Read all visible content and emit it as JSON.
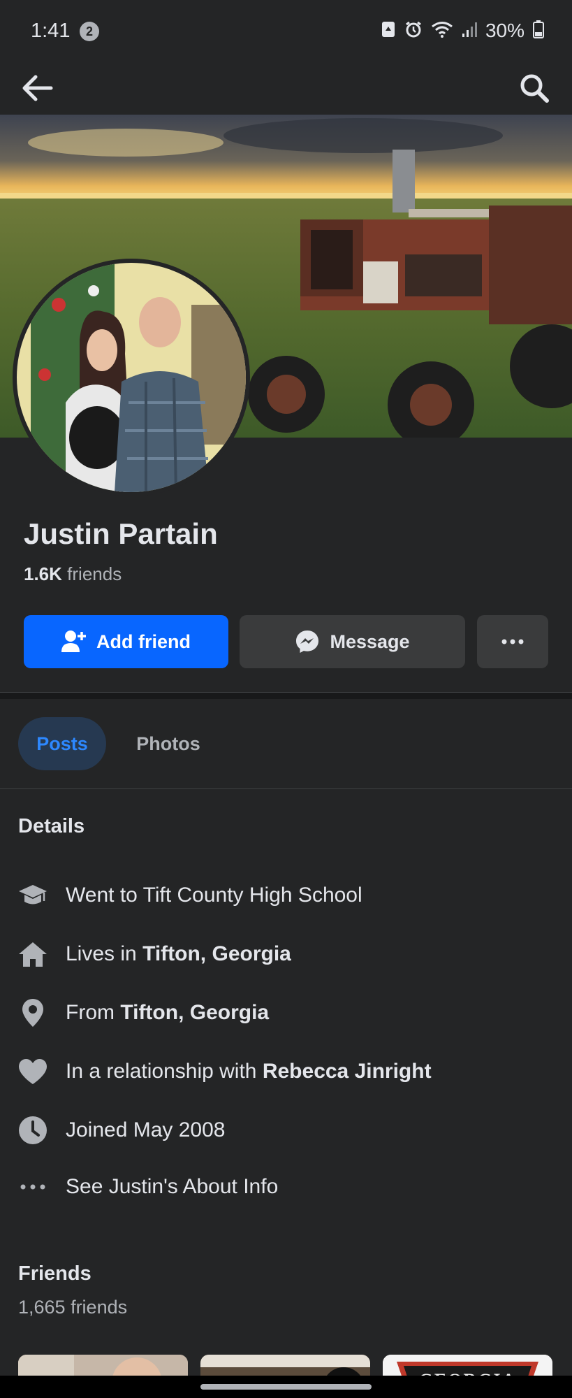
{
  "status_bar": {
    "time": "1:41",
    "notification_count": "2",
    "battery": "30%"
  },
  "profile": {
    "name": "Justin Partain",
    "friends_count_bold": "1.6K",
    "friends_count_label": "friends"
  },
  "actions": {
    "add_friend": "Add friend",
    "message": "Message"
  },
  "tabs": [
    {
      "label": "Posts",
      "active": true
    },
    {
      "label": "Photos",
      "active": false
    }
  ],
  "details": {
    "title": "Details",
    "items": [
      {
        "icon": "graduation-cap-icon",
        "prefix": "Went to Tift County High School",
        "bold": ""
      },
      {
        "icon": "home-icon",
        "prefix": "Lives in ",
        "bold": "Tifton, Georgia"
      },
      {
        "icon": "location-pin-icon",
        "prefix": "From ",
        "bold": "Tifton, Georgia"
      },
      {
        "icon": "heart-icon",
        "prefix": "In a relationship with ",
        "bold": "Rebecca Jinright"
      },
      {
        "icon": "clock-icon",
        "prefix": "Joined May 2008",
        "bold": ""
      },
      {
        "icon": "more-dots-icon",
        "prefix": "See Justin's About Info",
        "bold": ""
      }
    ]
  },
  "friends_section": {
    "title": "Friends",
    "count": "1,665 friends",
    "thumb_text": "GEORGIA"
  },
  "colors": {
    "background": "#242526",
    "primary_button": "#0866ff",
    "secondary_button": "#3a3b3c",
    "active_tab_bg": "#263951",
    "active_tab_text": "#2d88ff"
  }
}
